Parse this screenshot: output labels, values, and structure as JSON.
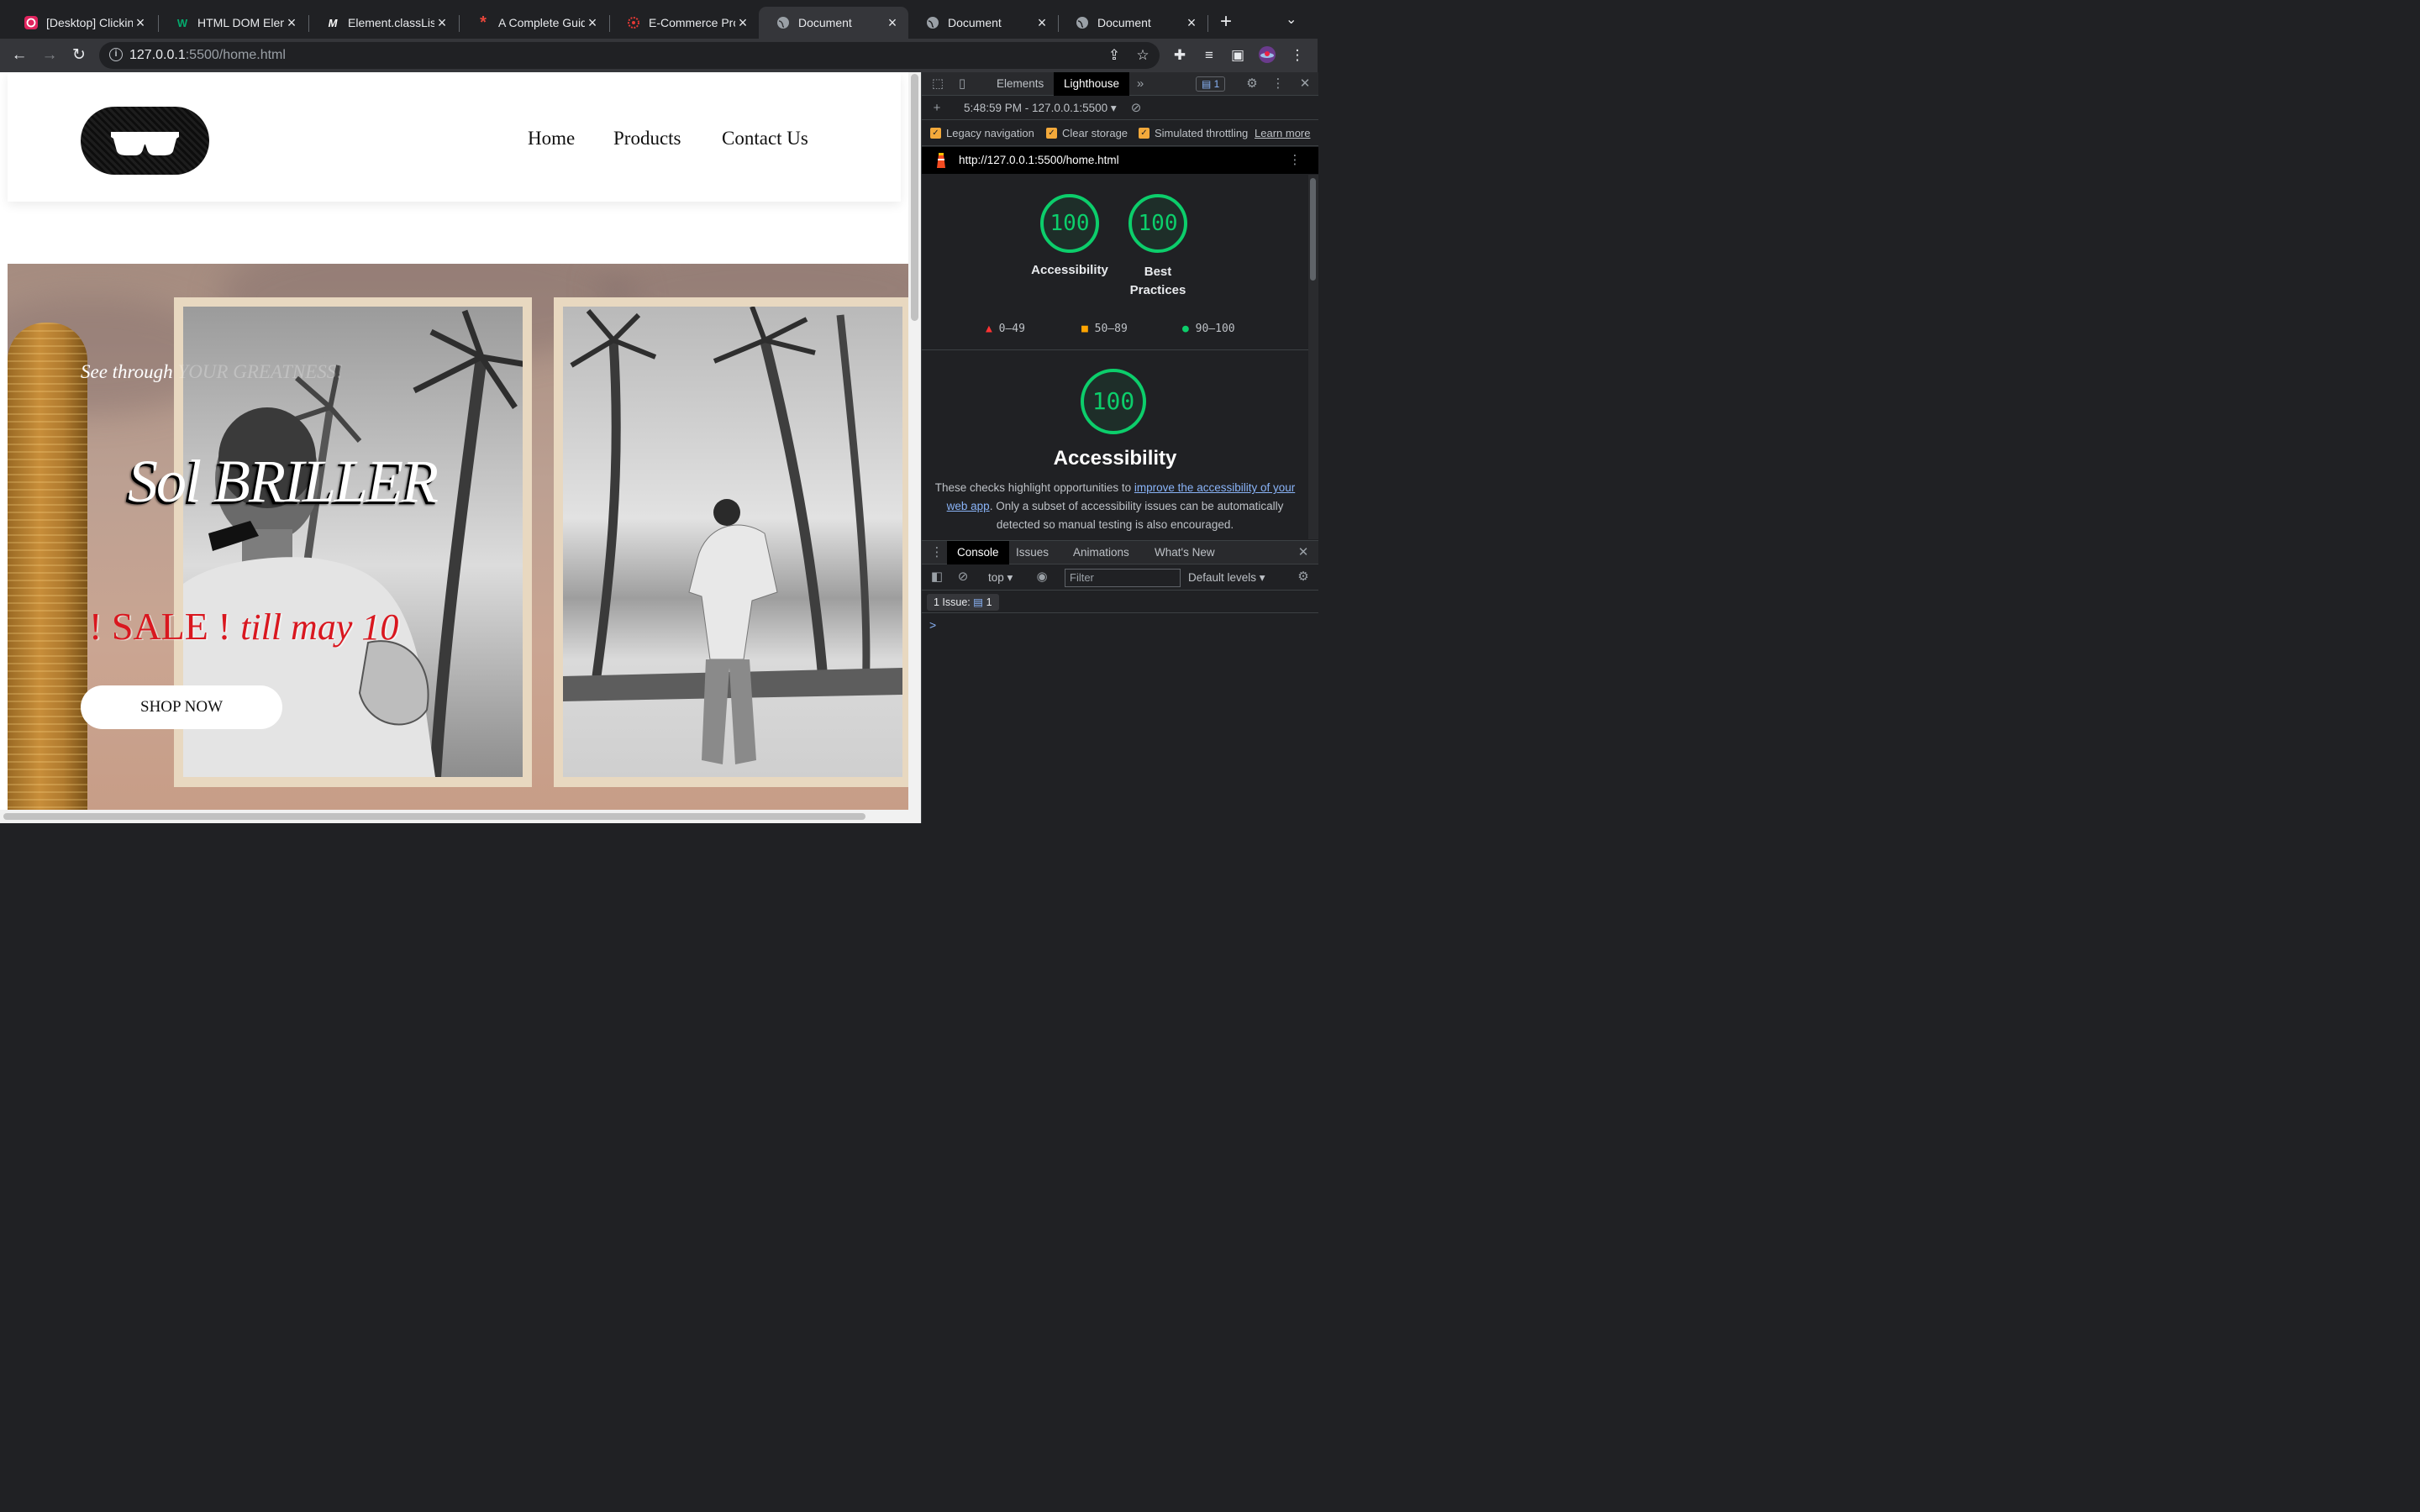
{
  "browser": {
    "tabs": [
      {
        "title": "[Desktop] Clicking",
        "icon": "music-app-icon",
        "color": "#e0245e"
      },
      {
        "title": "HTML DOM Eleme",
        "icon": "w3schools-icon",
        "color": "#04aa6d"
      },
      {
        "title": "Element.classList",
        "icon": "mdn-icon",
        "color": "#ffffff"
      },
      {
        "title": "A Complete Guide",
        "icon": "asterisk-icon",
        "color": "#e8463b"
      },
      {
        "title": "E-Commerce Proj",
        "icon": "gear-red-icon",
        "color": "#e53935"
      },
      {
        "title": "Document",
        "icon": "globe-icon",
        "color": "#9aa0a6",
        "active": true
      },
      {
        "title": "Document",
        "icon": "globe-icon",
        "color": "#9aa0a6"
      },
      {
        "title": "Document",
        "icon": "globe-icon",
        "color": "#9aa0a6"
      }
    ],
    "url_host": "127.0.0.1",
    "url_rest": ":5500/home.html"
  },
  "site": {
    "nav": [
      "Home",
      "Products",
      "Contact Us"
    ],
    "tagline": "See through",
    "tagline_faded": "YOUR GREATNESS!",
    "brand": "Sol BRILLER",
    "sale": "! SALE !",
    "sale_date": "till may 10",
    "cta": "SHOP NOW"
  },
  "devtools": {
    "tabs": [
      "Elements",
      "Lighthouse"
    ],
    "issue_count": "1",
    "report_time": "5:48:59 PM - 127.0.0.1:5500",
    "options": [
      "Legacy navigation",
      "Clear storage",
      "Simulated throttling"
    ],
    "learn_more": "Learn more",
    "report_url": "http://127.0.0.1:5500/home.html",
    "scores": [
      {
        "value": "100",
        "label": "Accessibility"
      },
      {
        "value": "100",
        "label": "Best Practices"
      }
    ],
    "legend": [
      "0–49",
      "50–89",
      "90–100"
    ],
    "legend_colors": [
      "#ff3333",
      "#ffa400",
      "#0cce6b"
    ],
    "section_score": "100",
    "section_title": "Accessibility",
    "desc_pre": "These checks highlight opportunities to ",
    "desc_link": "improve the accessibility of your web app",
    "desc_post": ". Only a subset of accessibility issues can be automatically detected so manual testing is also encouraged."
  },
  "console": {
    "tabs": [
      "Console",
      "Issues",
      "Animations",
      "What's New"
    ],
    "context": "top",
    "filter_placeholder": "Filter",
    "levels": "Default levels",
    "issues_label": "1 Issue:",
    "issues_count": "1",
    "prompt": ">"
  }
}
